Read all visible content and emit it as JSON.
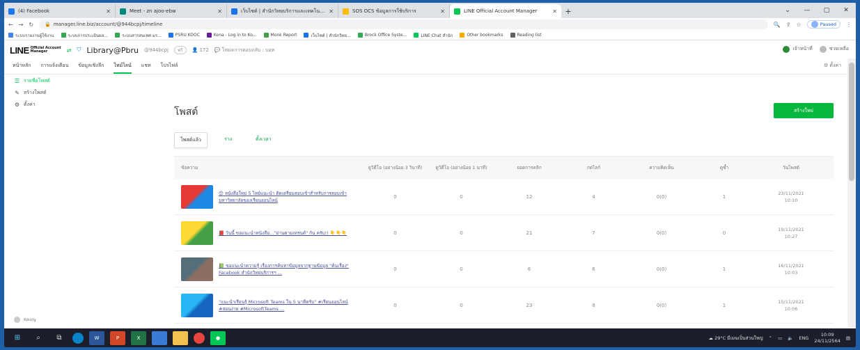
{
  "browser": {
    "tabs": [
      {
        "title": "(4) Facebook",
        "color": "#1877f2",
        "active": false
      },
      {
        "title": "Meet - zn ajoo-ebw",
        "color": "#00897b",
        "active": false
      },
      {
        "title": "เว็บไซต์ | สำนักวิทยบริการและเทคโนโลยี",
        "color": "#1a73e8",
        "active": false
      },
      {
        "title": "SOS OCS ข้อมูลการใช้บริการ",
        "color": "#fbbc04",
        "active": false
      },
      {
        "title": "LINE Official Account Manager",
        "color": "#06c755",
        "active": true
      }
    ],
    "new_tab": "+",
    "url": "manager.line.biz/account/@944bcpj/timeline",
    "paused_label": "Paused",
    "bookmarks": [
      {
        "label": "ระบบรายงานผู้ใช้งาน",
        "color": "#4285f4"
      },
      {
        "label": "ระบบการประเมินผล...",
        "color": "#34a853"
      },
      {
        "label": "ระบบสารสนเทศ มร...",
        "color": "#34a853"
      },
      {
        "label": "PSRU KOOC",
        "color": "#1a73e8"
      },
      {
        "label": "Kona - Log in to Ko...",
        "color": "#6a1b9a"
      },
      {
        "label": "Monk Report",
        "color": "#43a047"
      },
      {
        "label": "เว็บไซต์ | สำนักวิทย...",
        "color": "#1a73e8"
      },
      {
        "label": "Brock Office Syste...",
        "color": "#34a853"
      },
      {
        "label": "LINE Chat สำนัก",
        "color": "#06c755"
      },
      {
        "label": "Other bookmarks",
        "color": "#f9ab00"
      },
      {
        "label": "Reading list",
        "color": "#5f6368"
      }
    ]
  },
  "oa": {
    "logo": "LINE",
    "logo_sub_1": "Official Account",
    "logo_sub_2": "Manager",
    "account_name": "Library@Pbru",
    "account_id": "@944bcpj",
    "badge": "ฟรี",
    "friends": "172",
    "status": "โหมดการตอบกลับ : บอท",
    "user_label": "เจ้าหน้าที่",
    "help_label": "ช่วยเหลือ"
  },
  "mainnav": {
    "items": [
      "หน้าหลัก",
      "การแจ้งเตือน",
      "ข้อมูลเชิงลึก",
      "ไทม์ไลน์",
      "แชท",
      "โปรไฟล์"
    ],
    "active_index": 3,
    "settings": "ตั้งค่า"
  },
  "sidebar": {
    "items": [
      {
        "icon": "list",
        "label": "รายชื่อโพสต์",
        "active": true
      },
      {
        "icon": "edit",
        "label": "สร้างโพสต์",
        "active": false
      },
      {
        "icon": "gear",
        "label": "ตั้งค่า",
        "active": false
      }
    ],
    "bottom": "ย่อเมนู"
  },
  "page": {
    "title": "โพสต์",
    "create_button": "สร้างใหม่",
    "filters": [
      "โพสต์แล้ว",
      "ร่าง",
      "ตั้งเวลา"
    ],
    "active_filter": 0
  },
  "table": {
    "headers": [
      "ข้อความ",
      "ดูวิดีโอ (อย่างน้อย 3 วินาที)",
      "ดูวิดีโอ (อย่างน้อย 1 นาที)",
      "ยอดการคลิก",
      "กดไลก์",
      "ความคิดเห็น",
      "ดูซ้ำ",
      "วันโพสต์"
    ],
    "rows": [
      {
        "message": "😊 หนังสือใหม่ 5 ไทย์แนะนำ ติดเตรียมสอบเข้าสำหรับการสอบเข้ามหาวิทยาลัยของเรียนออนไลน์",
        "v3s": "0",
        "v1m": "0",
        "clicks": "12",
        "likes": "4",
        "comments": "0(0)",
        "shares": "1",
        "date": "23/11/2021",
        "time": "10:10",
        "thumb": [
          "#e53935",
          "#1e88e5"
        ]
      },
      {
        "message": "📕 วันนี้ ขอแนะนำหนังสือ...\"อ่านตามเทรนด์\" กัน ครับ!! 👇👇👇",
        "v3s": "0",
        "v1m": "0",
        "clicks": "21",
        "likes": "7",
        "comments": "0(0)",
        "shares": "0",
        "date": "19/11/2021",
        "time": "10:27",
        "thumb": [
          "#fdd835",
          "#43a047"
        ]
      },
      {
        "message": "📗 ขอแนะนำความรู้ เรื่องการค้นหาข้อมูลจากฐานข้อมูล \"ค้นเรื่อง\" Facebook สำนักวิทยบริการฯ ...",
        "v3s": "0",
        "v1m": "0",
        "clicks": "6",
        "likes": "6",
        "comments": "0(0)",
        "shares": "1",
        "date": "16/11/2021",
        "time": "10:03",
        "thumb": [
          "#546e7a",
          "#8d6e63"
        ]
      },
      {
        "message": "\"แนะนำเรียนรู้ Microsoft Teams ใน 5 นาทีครับ\" #เรียนออนไลน์ #สอนง่าย #MicrosoftTeams ...",
        "v3s": "0",
        "v1m": "0",
        "clicks": "23",
        "likes": "8",
        "comments": "0(0)",
        "shares": "1",
        "date": "15/11/2021",
        "time": "10:06",
        "thumb": [
          "#29b6f6",
          "#1565c0"
        ]
      }
    ]
  },
  "taskbar": {
    "weather": "29°C มีเมฆเป็นส่วนใหญ่",
    "lang": "ENG",
    "time": "10:09",
    "date": "24/11/2564"
  }
}
